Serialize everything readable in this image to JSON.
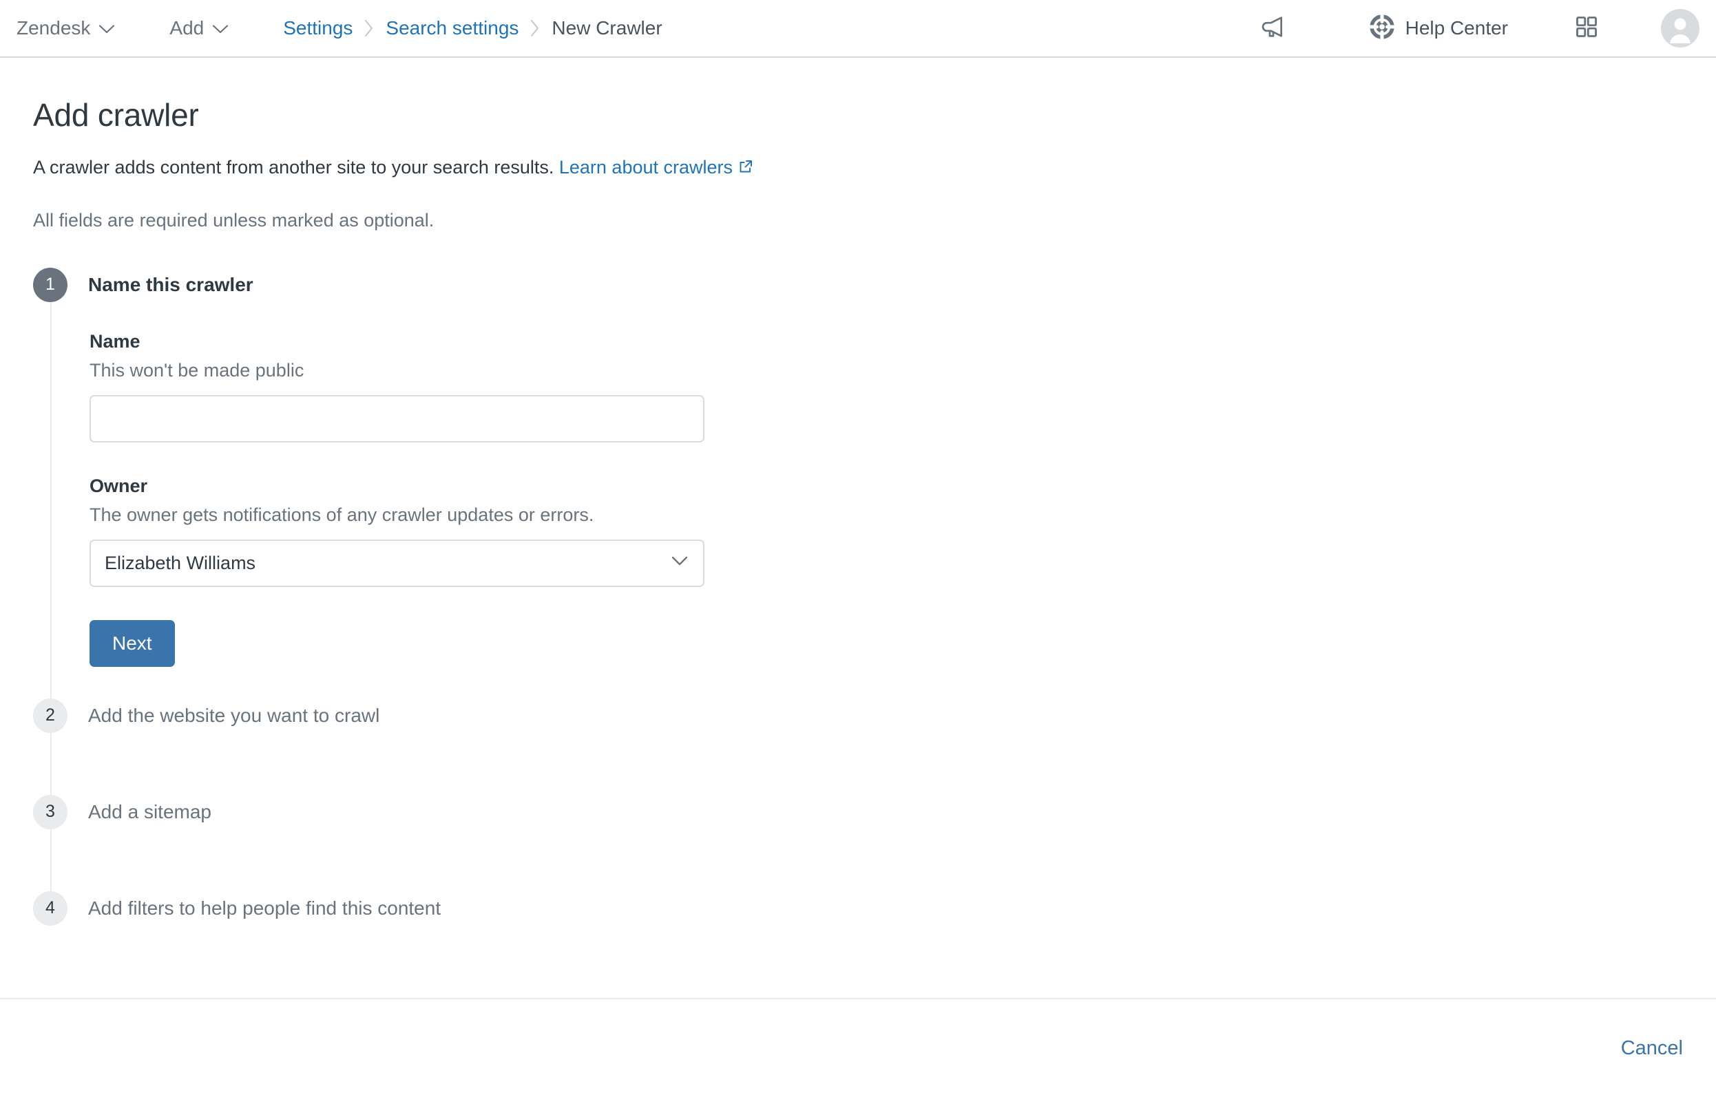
{
  "topbar": {
    "product_menu": {
      "label": "Zendesk",
      "icon": "chevron-down-icon"
    },
    "add_menu": {
      "label": "Add",
      "icon": "chevron-down-icon"
    },
    "breadcrumb": [
      {
        "label": "Settings",
        "current": false
      },
      {
        "label": "Search settings",
        "current": false
      },
      {
        "label": "New Crawler",
        "current": true
      }
    ],
    "announcements_icon": "megaphone-icon",
    "help_center": {
      "label": "Help Center",
      "icon": "lifebuoy-icon"
    },
    "apps_icon": "grid-apps-icon",
    "avatar_icon": "user-avatar-icon"
  },
  "page": {
    "title": "Add crawler",
    "description_text": "A crawler adds content from another site to your search results.",
    "description_link": "Learn about crawlers",
    "description_link_icon": "external-link-icon",
    "required_note": "All fields are required unless marked as optional."
  },
  "steps": [
    {
      "number": "1",
      "title": "Name this crawler",
      "state": "active"
    },
    {
      "number": "2",
      "title": "Add the website you want to crawl",
      "state": "inactive"
    },
    {
      "number": "3",
      "title": "Add a sitemap",
      "state": "inactive"
    },
    {
      "number": "4",
      "title": "Add filters to help people find this content",
      "state": "inactive"
    }
  ],
  "form": {
    "name_field": {
      "label": "Name",
      "hint": "This won't be made public",
      "value": "",
      "placeholder": ""
    },
    "owner_field": {
      "label": "Owner",
      "hint": "The owner gets notifications of any crawler updates or errors.",
      "selected": "Elizabeth Williams",
      "caret_icon": "chevron-down-icon"
    },
    "next_button": "Next"
  },
  "footer": {
    "cancel": "Cancel"
  },
  "colors": {
    "accent_blue": "#1f73b7",
    "button_blue": "#3a74ab",
    "step_active": "#68737d",
    "step_inactive": "#e9ebed",
    "text_primary": "#2f3941",
    "text_secondary": "#68737d",
    "border": "#d8dcde"
  }
}
